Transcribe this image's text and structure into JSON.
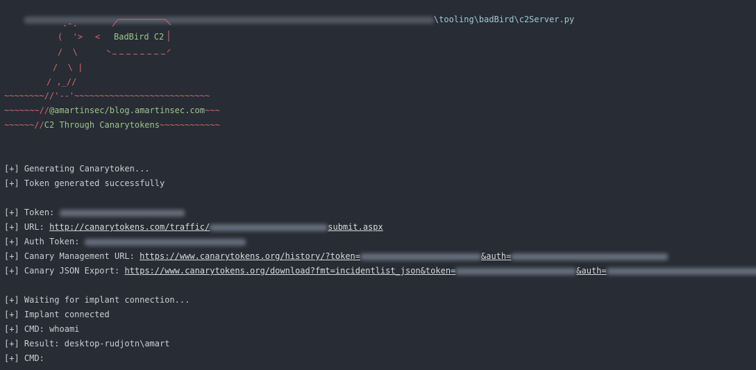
{
  "command": {
    "path_tail": "\\tooling\\badBird\\c2Server.py"
  },
  "banner": {
    "title": "BadBird C2",
    "art_lines": [
      ".-.",
      "(  '>",
      "/  \\",
      "/  \\ |",
      "/ ,_//",
      "~~~~~~~~//'--'~~~~~~~~~~~~~~~~~~~~~~~~~~~",
      "~~~~~~~//@amartinsec/blog.amartinsec.com~~~",
      "~~~~~~//C2 Through Canarytokens~~~~~~~~~~~~"
    ],
    "handle": "@amartinsec/blog.amartinsec.com",
    "subtitle": "C2 Through Canarytokens"
  },
  "output": {
    "prefix": "[+]",
    "generating": "Generating Canarytoken...",
    "generated": "Token generated successfully",
    "token_label": "Token:",
    "url_label": "URL:",
    "url_start": "http://canarytokens.com/traffic/",
    "url_end": "submit.aspx",
    "auth_label": "Auth Token:",
    "mgmt_label": "Canary Management URL:",
    "mgmt_url": "https://www.canarytokens.org/history/?token=",
    "mgmt_auth": "&auth=",
    "json_label": "Canary JSON Export:",
    "json_url": "https://www.canarytokens.org/download?fmt=incidentlist_json&token=",
    "json_auth": "&auth=",
    "waiting": "Waiting for implant connection...",
    "connected": "Implant connected",
    "cmd_label": "CMD:",
    "cmd_value": "whoami",
    "result_label": "Result:",
    "result_value": "desktop-rudjotn\\amart",
    "cmd_prompt": "CMD:"
  },
  "colors": {
    "background": "#282c34",
    "text": "#c9cdd4",
    "art_red": "#d16a6f",
    "art_green": "#9cc589"
  }
}
